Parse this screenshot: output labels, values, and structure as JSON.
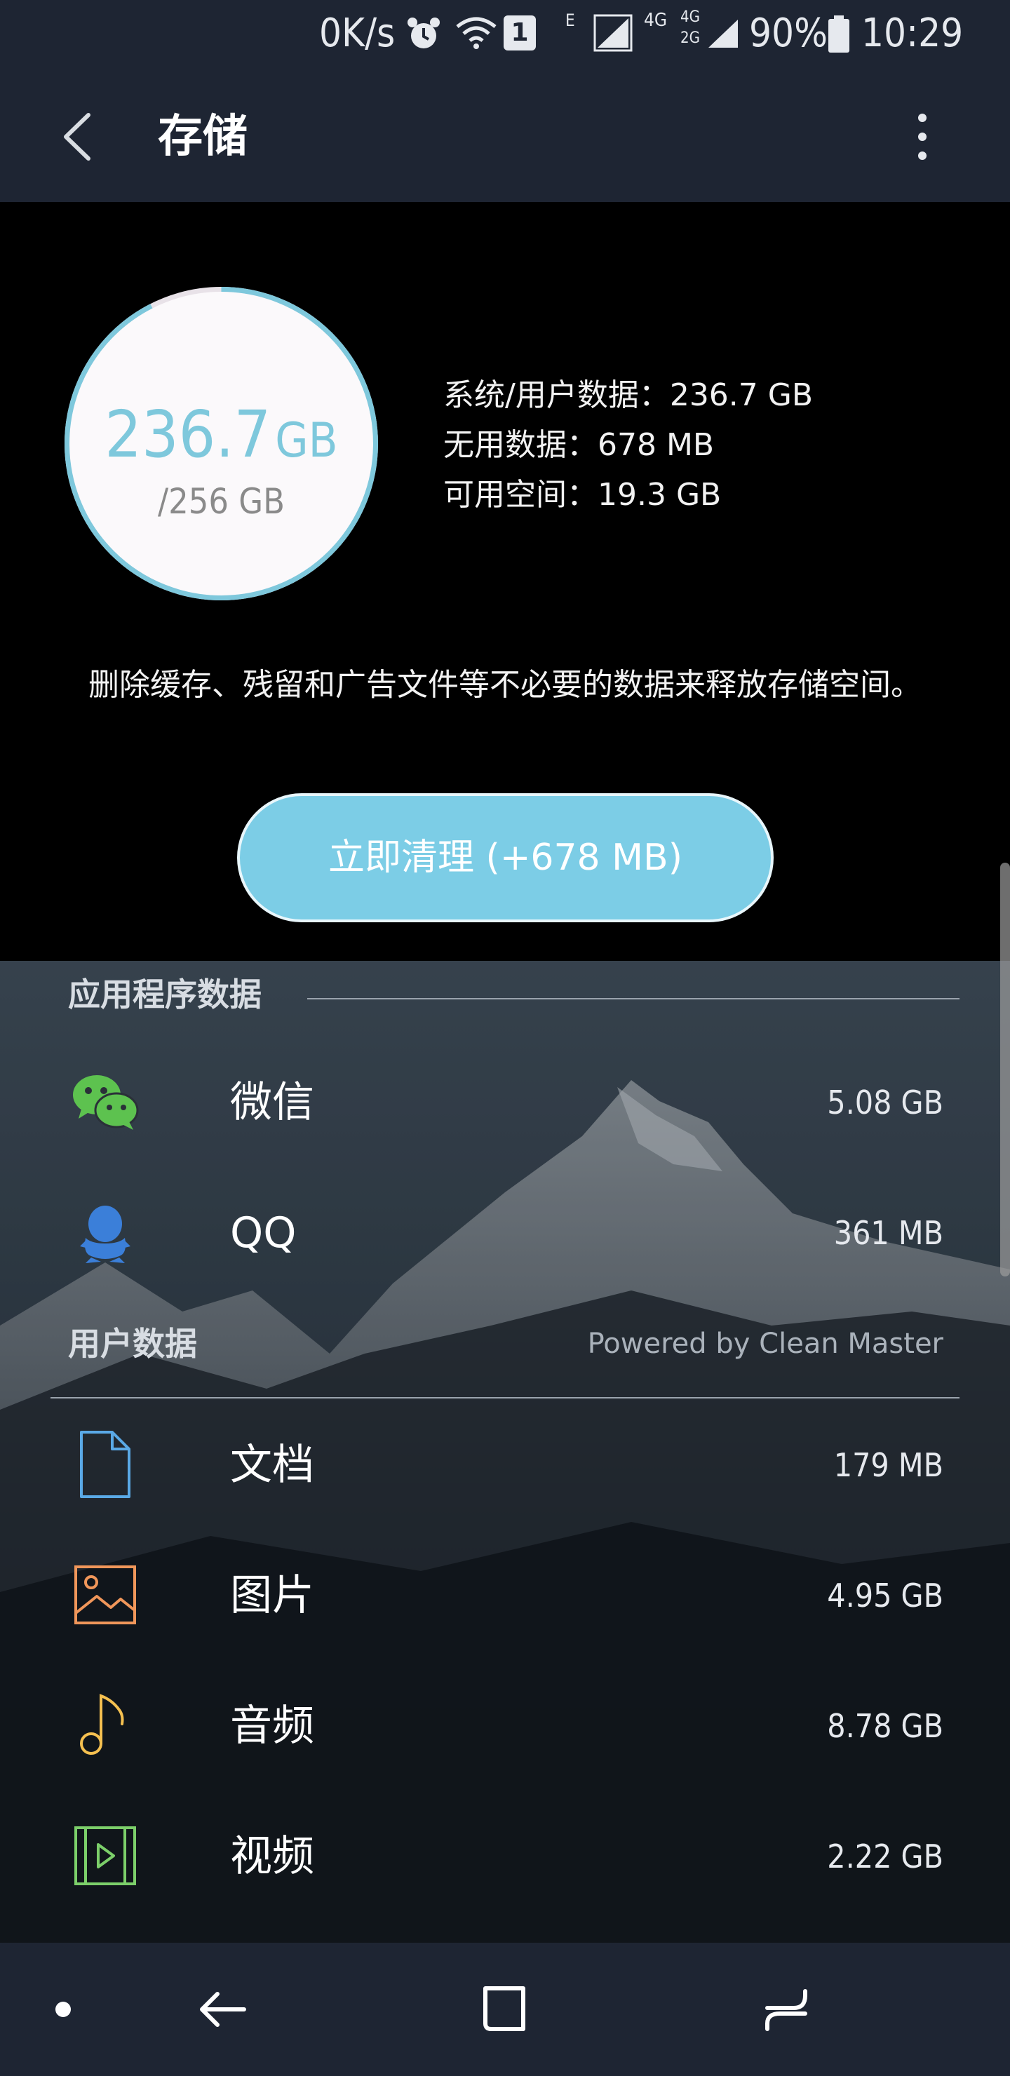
{
  "status_bar": {
    "network_speed": "0K/s",
    "battery": "90%",
    "time": "10:29",
    "sim_slot": "1",
    "network_e": "E",
    "network_4g": "4G",
    "network_4g_2g_top": "4G",
    "network_4g_2g_bottom": "2G"
  },
  "app_bar": {
    "title": "存储"
  },
  "storage": {
    "used_value": "236.7",
    "used_unit": "GB",
    "total": "/256 GB",
    "used_fraction": 0.925,
    "system_user_data": "系统/用户数据：236.7 GB",
    "junk_data": "无用数据：678 MB",
    "available": "可用空间：19.3 GB"
  },
  "description": "删除缓存、残留和广告文件等不必要的数据来释放存储空间。",
  "clean_button_label": "立即清理 (+678 MB)",
  "app_data": {
    "title": "应用程序数据",
    "items": [
      {
        "label": "微信",
        "size": "5.08 GB",
        "icon": "wechat-icon"
      },
      {
        "label": "QQ",
        "size": "361 MB",
        "icon": "qq-icon"
      }
    ]
  },
  "user_data": {
    "title": "用户数据",
    "powered_by": "Powered by Clean Master",
    "items": [
      {
        "label": "文档",
        "size": "179 MB",
        "icon": "document-icon"
      },
      {
        "label": "图片",
        "size": "4.95 GB",
        "icon": "image-icon"
      },
      {
        "label": "音频",
        "size": "8.78 GB",
        "icon": "audio-icon"
      },
      {
        "label": "视频",
        "size": "2.22 GB",
        "icon": "video-icon"
      }
    ]
  },
  "colors": {
    "accent": "#7ccde6",
    "wechat": "#5dc24f",
    "qq": "#3b7fd9",
    "document": "#5aa9e6",
    "image": "#f0965a",
    "audio": "#f5c050",
    "video": "#7ccf6a"
  }
}
